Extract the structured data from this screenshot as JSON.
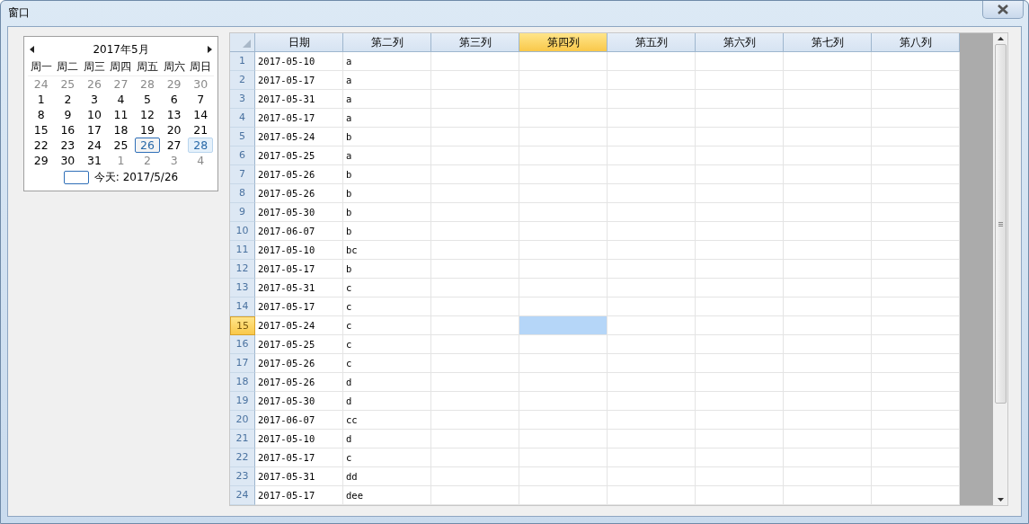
{
  "window": {
    "title": "窗口"
  },
  "calendar": {
    "month": "2017年5月",
    "weekdays": [
      "周一",
      "周二",
      "周三",
      "周四",
      "周五",
      "周六",
      "周日"
    ],
    "weeks": [
      [
        {
          "label": "24",
          "muted": true,
          "today": false,
          "selected": false
        },
        {
          "label": "25",
          "muted": true,
          "today": false,
          "selected": false
        },
        {
          "label": "26",
          "muted": true,
          "today": false,
          "selected": false
        },
        {
          "label": "27",
          "muted": true,
          "today": false,
          "selected": false
        },
        {
          "label": "28",
          "muted": true,
          "today": false,
          "selected": false
        },
        {
          "label": "29",
          "muted": true,
          "today": false,
          "selected": false
        },
        {
          "label": "30",
          "muted": true,
          "today": false,
          "selected": false
        }
      ],
      [
        {
          "label": "1",
          "muted": false,
          "today": false,
          "selected": false
        },
        {
          "label": "2",
          "muted": false,
          "today": false,
          "selected": false
        },
        {
          "label": "3",
          "muted": false,
          "today": false,
          "selected": false
        },
        {
          "label": "4",
          "muted": false,
          "today": false,
          "selected": false
        },
        {
          "label": "5",
          "muted": false,
          "today": false,
          "selected": false
        },
        {
          "label": "6",
          "muted": false,
          "today": false,
          "selected": false
        },
        {
          "label": "7",
          "muted": false,
          "today": false,
          "selected": false
        }
      ],
      [
        {
          "label": "8",
          "muted": false,
          "today": false,
          "selected": false
        },
        {
          "label": "9",
          "muted": false,
          "today": false,
          "selected": false
        },
        {
          "label": "10",
          "muted": false,
          "today": false,
          "selected": false
        },
        {
          "label": "11",
          "muted": false,
          "today": false,
          "selected": false
        },
        {
          "label": "12",
          "muted": false,
          "today": false,
          "selected": false
        },
        {
          "label": "13",
          "muted": false,
          "today": false,
          "selected": false
        },
        {
          "label": "14",
          "muted": false,
          "today": false,
          "selected": false
        }
      ],
      [
        {
          "label": "15",
          "muted": false,
          "today": false,
          "selected": false
        },
        {
          "label": "16",
          "muted": false,
          "today": false,
          "selected": false
        },
        {
          "label": "17",
          "muted": false,
          "today": false,
          "selected": false
        },
        {
          "label": "18",
          "muted": false,
          "today": false,
          "selected": false
        },
        {
          "label": "19",
          "muted": false,
          "today": false,
          "selected": false
        },
        {
          "label": "20",
          "muted": false,
          "today": false,
          "selected": false
        },
        {
          "label": "21",
          "muted": false,
          "today": false,
          "selected": false
        }
      ],
      [
        {
          "label": "22",
          "muted": false,
          "today": false,
          "selected": false
        },
        {
          "label": "23",
          "muted": false,
          "today": false,
          "selected": false
        },
        {
          "label": "24",
          "muted": false,
          "today": false,
          "selected": false
        },
        {
          "label": "25",
          "muted": false,
          "today": false,
          "selected": false
        },
        {
          "label": "26",
          "muted": false,
          "today": true,
          "selected": false
        },
        {
          "label": "27",
          "muted": false,
          "today": false,
          "selected": false
        },
        {
          "label": "28",
          "muted": false,
          "today": false,
          "selected": true
        }
      ],
      [
        {
          "label": "29",
          "muted": false,
          "today": false,
          "selected": false
        },
        {
          "label": "30",
          "muted": false,
          "today": false,
          "selected": false
        },
        {
          "label": "31",
          "muted": false,
          "today": false,
          "selected": false
        },
        {
          "label": "1",
          "muted": true,
          "today": false,
          "selected": false
        },
        {
          "label": "2",
          "muted": true,
          "today": false,
          "selected": false
        },
        {
          "label": "3",
          "muted": true,
          "today": false,
          "selected": false
        },
        {
          "label": "4",
          "muted": true,
          "today": false,
          "selected": false
        }
      ]
    ],
    "today_text": "今天: 2017/5/26"
  },
  "table": {
    "columns": [
      {
        "label": "日期",
        "selected": false
      },
      {
        "label": "第二列",
        "selected": false
      },
      {
        "label": "第三列",
        "selected": false
      },
      {
        "label": "第四列",
        "selected": true
      },
      {
        "label": "第五列",
        "selected": false
      },
      {
        "label": "第六列",
        "selected": false
      },
      {
        "label": "第七列",
        "selected": false
      },
      {
        "label": "第八列",
        "selected": false
      }
    ],
    "rows": [
      {
        "number": "1",
        "date": "2017-05-10",
        "column_2": "a",
        "selected": false
      },
      {
        "number": "2",
        "date": "2017-05-17",
        "column_2": "a",
        "selected": false
      },
      {
        "number": "3",
        "date": "2017-05-31",
        "column_2": "a",
        "selected": false
      },
      {
        "number": "4",
        "date": "2017-05-17",
        "column_2": "a",
        "selected": false
      },
      {
        "number": "5",
        "date": "2017-05-24",
        "column_2": "b",
        "selected": false
      },
      {
        "number": "6",
        "date": "2017-05-25",
        "column_2": "a",
        "selected": false
      },
      {
        "number": "7",
        "date": "2017-05-26",
        "column_2": "b",
        "selected": false
      },
      {
        "number": "8",
        "date": "2017-05-26",
        "column_2": "b",
        "selected": false
      },
      {
        "number": "9",
        "date": "2017-05-30",
        "column_2": "b",
        "selected": false
      },
      {
        "number": "10",
        "date": "2017-06-07",
        "column_2": "b",
        "selected": false
      },
      {
        "number": "11",
        "date": "2017-05-10",
        "column_2": "bc",
        "selected": false
      },
      {
        "number": "12",
        "date": "2017-05-17",
        "column_2": "b",
        "selected": false
      },
      {
        "number": "13",
        "date": "2017-05-31",
        "column_2": "c",
        "selected": false
      },
      {
        "number": "14",
        "date": "2017-05-17",
        "column_2": "c",
        "selected": false
      },
      {
        "number": "15",
        "date": "2017-05-24",
        "column_2": "c",
        "selected": true
      },
      {
        "number": "16",
        "date": "2017-05-25",
        "column_2": "c",
        "selected": false
      },
      {
        "number": "17",
        "date": "2017-05-26",
        "column_2": "c",
        "selected": false
      },
      {
        "number": "18",
        "date": "2017-05-26",
        "column_2": "d",
        "selected": false
      },
      {
        "number": "19",
        "date": "2017-05-30",
        "column_2": "d",
        "selected": false
      },
      {
        "number": "20",
        "date": "2017-06-07",
        "column_2": "cc",
        "selected": false
      },
      {
        "number": "21",
        "date": "2017-05-10",
        "column_2": "d",
        "selected": false
      },
      {
        "number": "22",
        "date": "2017-05-17",
        "column_2": "c",
        "selected": false
      },
      {
        "number": "23",
        "date": "2017-05-31",
        "column_2": "dd",
        "selected": false
      },
      {
        "number": "24",
        "date": "2017-05-17",
        "column_2": "dee",
        "selected": false
      }
    ]
  }
}
